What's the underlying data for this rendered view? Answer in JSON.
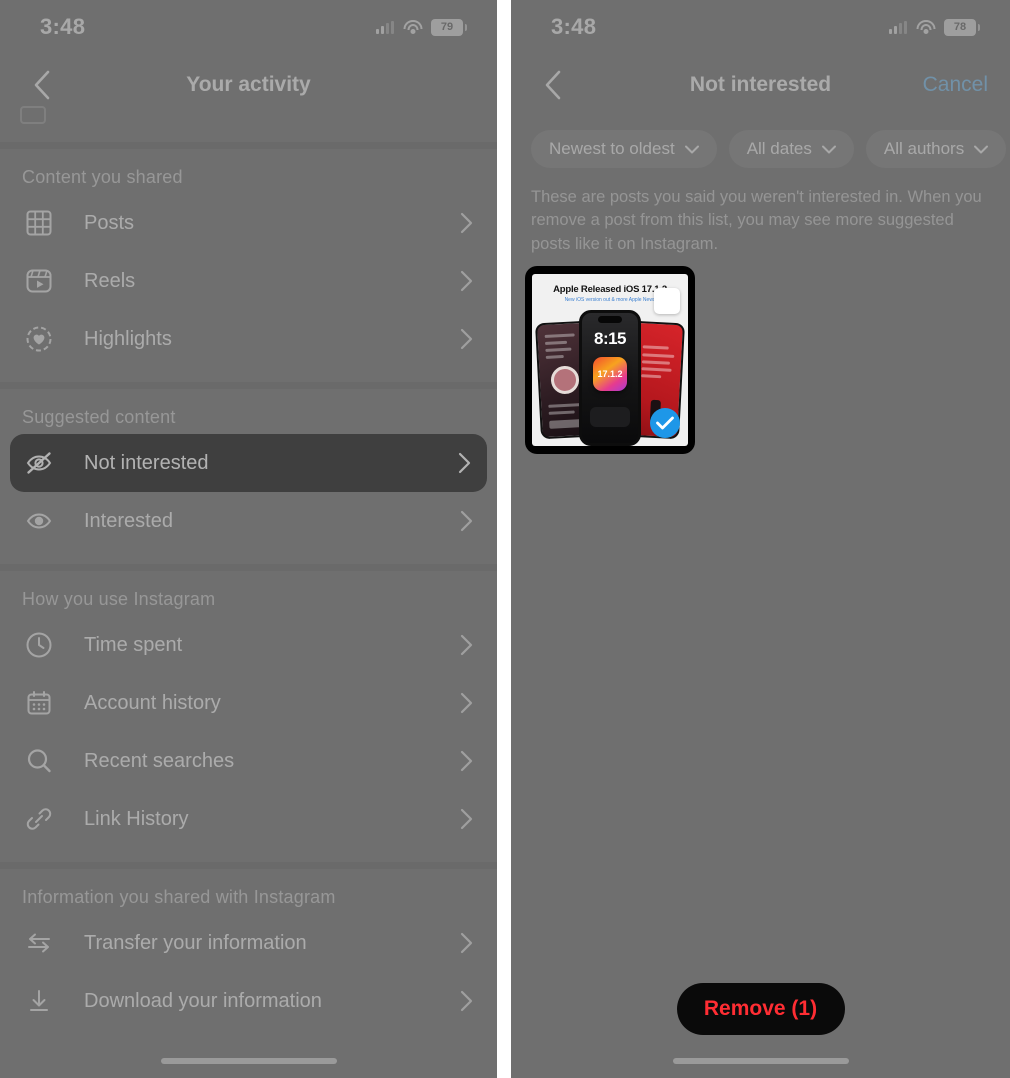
{
  "left_phone": {
    "status_bar": {
      "time": "3:48",
      "battery": "79",
      "signal_icon": "cellular-signal-icon",
      "wifi_icon": "wifi-icon",
      "battery_icon": "battery-icon"
    },
    "nav": {
      "back_icon": "chevron-left-icon",
      "title": "Your activity"
    },
    "sections": [
      {
        "title": "Content you shared",
        "items": [
          {
            "label": "Posts",
            "icon": "grid-icon"
          },
          {
            "label": "Reels",
            "icon": "reels-icon"
          },
          {
            "label": "Highlights",
            "icon": "highlights-heart-icon"
          }
        ]
      },
      {
        "title": "Suggested content",
        "items": [
          {
            "label": "Not interested",
            "icon": "eye-slash-icon",
            "highlighted": true
          },
          {
            "label": "Interested",
            "icon": "eye-icon",
            "highlighted": false
          }
        ]
      },
      {
        "title": "How you use Instagram",
        "items": [
          {
            "label": "Time spent",
            "icon": "clock-icon"
          },
          {
            "label": "Account history",
            "icon": "calendar-icon"
          },
          {
            "label": "Recent searches",
            "icon": "search-icon"
          },
          {
            "label": "Link History",
            "icon": "link-icon"
          }
        ]
      },
      {
        "title": "Information you shared with Instagram",
        "items": [
          {
            "label": "Transfer your information",
            "icon": "transfer-arrows-icon"
          },
          {
            "label": "Download your information",
            "icon": "download-icon"
          }
        ]
      }
    ],
    "chevron_icon": "chevron-right-icon"
  },
  "right_phone": {
    "status_bar": {
      "time": "3:48",
      "battery": "78",
      "signal_icon": "cellular-signal-icon",
      "wifi_icon": "wifi-icon",
      "battery_icon": "battery-icon"
    },
    "nav": {
      "back_icon": "chevron-left-icon",
      "title": "Not interested",
      "cancel_label": "Cancel"
    },
    "filters": [
      {
        "label": "Newest to oldest",
        "icon": "chevron-down-icon"
      },
      {
        "label": "All dates",
        "icon": "chevron-down-icon"
      },
      {
        "label": "All authors",
        "icon": "chevron-down-icon"
      }
    ],
    "description": "These are posts you said you weren't interested in. When you remove a post from this list, you may see more suggested posts like it on Instagram.",
    "post": {
      "headline": "Apple Released iOS 17.1.2",
      "subhead": "New iOS version out & more Apple News",
      "phone_clock": "8:15",
      "app_badge": "17.1.2",
      "selected": true,
      "check_icon": "check-circle-icon"
    },
    "remove_button": {
      "label": "Remove (1)",
      "color": "#ff2d33"
    }
  },
  "colors": {
    "screen_background": "#6b6b6b",
    "spotlight_background": "#000000",
    "accent_blue": "#1e97e8",
    "cancel_blue": "#6fb6e8",
    "danger_red": "#ff2d33"
  }
}
